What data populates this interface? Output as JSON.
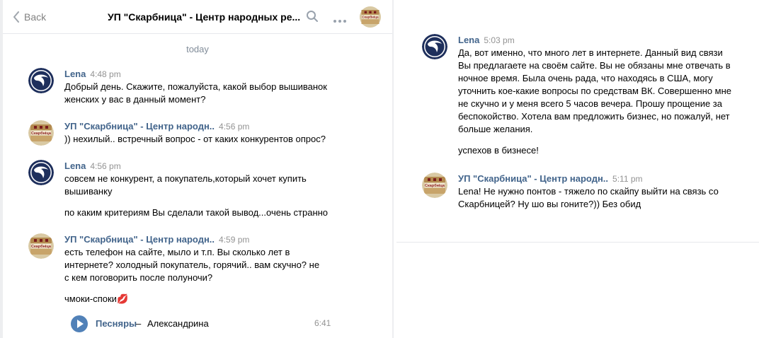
{
  "header": {
    "back_label": "Back",
    "title": "УП \"Скарбница\" - Центр народных ре..."
  },
  "day_separator": "today",
  "messages": [
    {
      "author": "Lena",
      "time": "4:48 pm",
      "paragraphs": [
        "Добрый день. Скажите, пожалуйста, какой выбор вышиванок женских у вас в данный момент?"
      ]
    },
    {
      "author": "УП \"Скарбница\" - Центр народн..",
      "time": "4:56 pm",
      "paragraphs": [
        ")) нехилый.. встречный вопрос - от каких конкурентов опрос?"
      ]
    },
    {
      "author": "Lena",
      "time": "4:56 pm",
      "paragraphs": [
        "совсем не конкурент, а покупатель,который хочет купить вышиванку",
        "по каким критериям Вы сделали такой вывод...очень странно"
      ]
    },
    {
      "author": "УП \"Скарбница\" - Центр народн..",
      "time": "4:59 pm",
      "paragraphs": [
        "есть телефон на сайте, мыло и т.п. Вы сколько лет в интернете? холодный покупатель, горячий.. вам скучно? не с кем поговорить после полуночи?",
        "чмоки-споки💋"
      ]
    }
  ],
  "audio": {
    "artist": "Песняры",
    "separator": "–",
    "track": "Александрина",
    "duration": "6:41"
  },
  "right_messages": [
    {
      "author": "Lena",
      "time": "5:03 pm",
      "paragraphs": [
        "Да, вот именно, что много лет в интернете. Данный вид связи Вы предлагаете на своём сайте. Вы не обязаны мне отвечать в ночное время. Была очень рада, что находясь в США, могу уточнить кое-какие вопросы по средствам ВК. Совершенно мне не скучно и у меня всего 5 часов вечера. Прошу прощение за беспокойство. Хотела вам предложить бизнес, но пожалуй, нет больше желания.",
        "успехов в бизнесе!"
      ]
    },
    {
      "author": "УП \"Скарбница\" - Центр народн..",
      "time": "5:11 pm",
      "paragraphs": [
        "Lena! Не нужно понтов - тяжело по скайпу выйти на связь со Скарбницей? Ну шо вы гоните?)) Без обид"
      ]
    }
  ],
  "avatars": {
    "lena": "lena-logo-avatar",
    "shop": "skarbnitsa-logo-avatar"
  },
  "colors": {
    "author": "#42648b",
    "time": "#939393",
    "accent": "#5181b8",
    "lena_avatar": "#1e2f5c"
  }
}
